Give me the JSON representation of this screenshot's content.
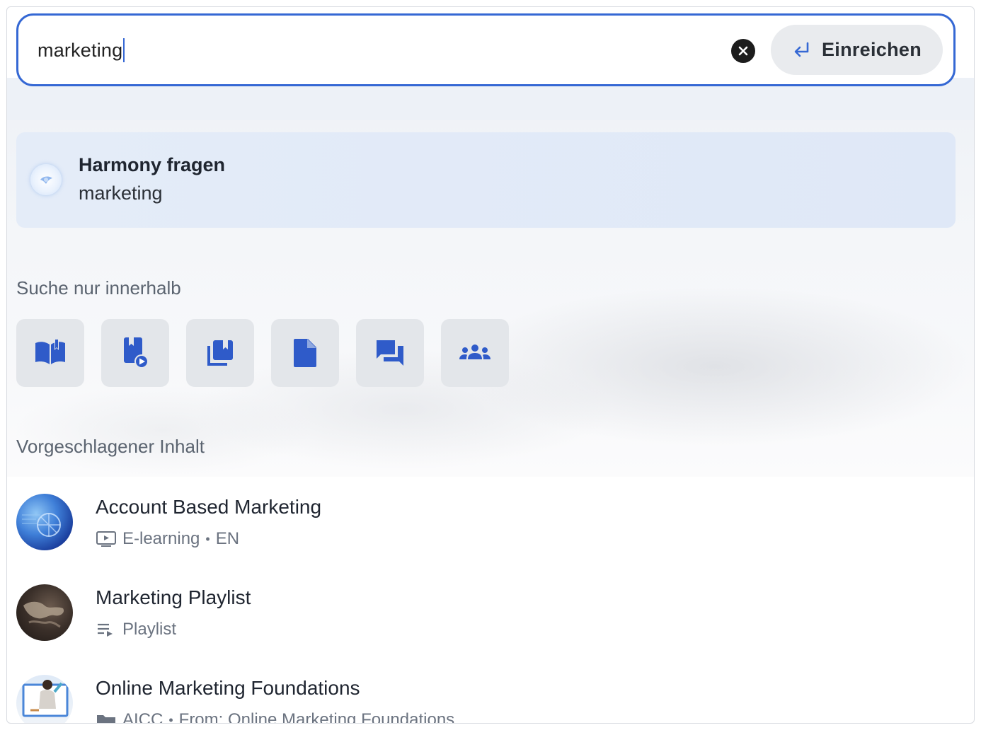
{
  "search": {
    "value": "marketing",
    "submit_label": "Einreichen"
  },
  "harmony": {
    "title": "Harmony fragen",
    "query": "marketing"
  },
  "scope": {
    "label": "Suche nur innerhalb",
    "filters": [
      {
        "icon": "book-open-icon"
      },
      {
        "icon": "course-play-icon"
      },
      {
        "icon": "library-stack-icon"
      },
      {
        "icon": "document-icon"
      },
      {
        "icon": "forum-chat-icon"
      },
      {
        "icon": "groups-icon"
      }
    ]
  },
  "suggested": {
    "label": "Vorgeschlagener Inhalt",
    "items": [
      {
        "title": "Account Based Marketing",
        "type": "E-learning",
        "lang": "EN",
        "type_icon": "monitor-play-icon"
      },
      {
        "title": "Marketing Playlist",
        "type": "Playlist",
        "type_icon": "playlist-icon"
      },
      {
        "title": "Online Marketing Foundations",
        "type": "AICC",
        "source": "From: Online Marketing Foundations",
        "type_icon": "folder-icon"
      }
    ]
  },
  "colors": {
    "accent": "#3568d4",
    "icon_blue": "#2f5bc9",
    "filter_bg": "#e3e6ea",
    "harmony_bg": "#e0e9f7"
  }
}
